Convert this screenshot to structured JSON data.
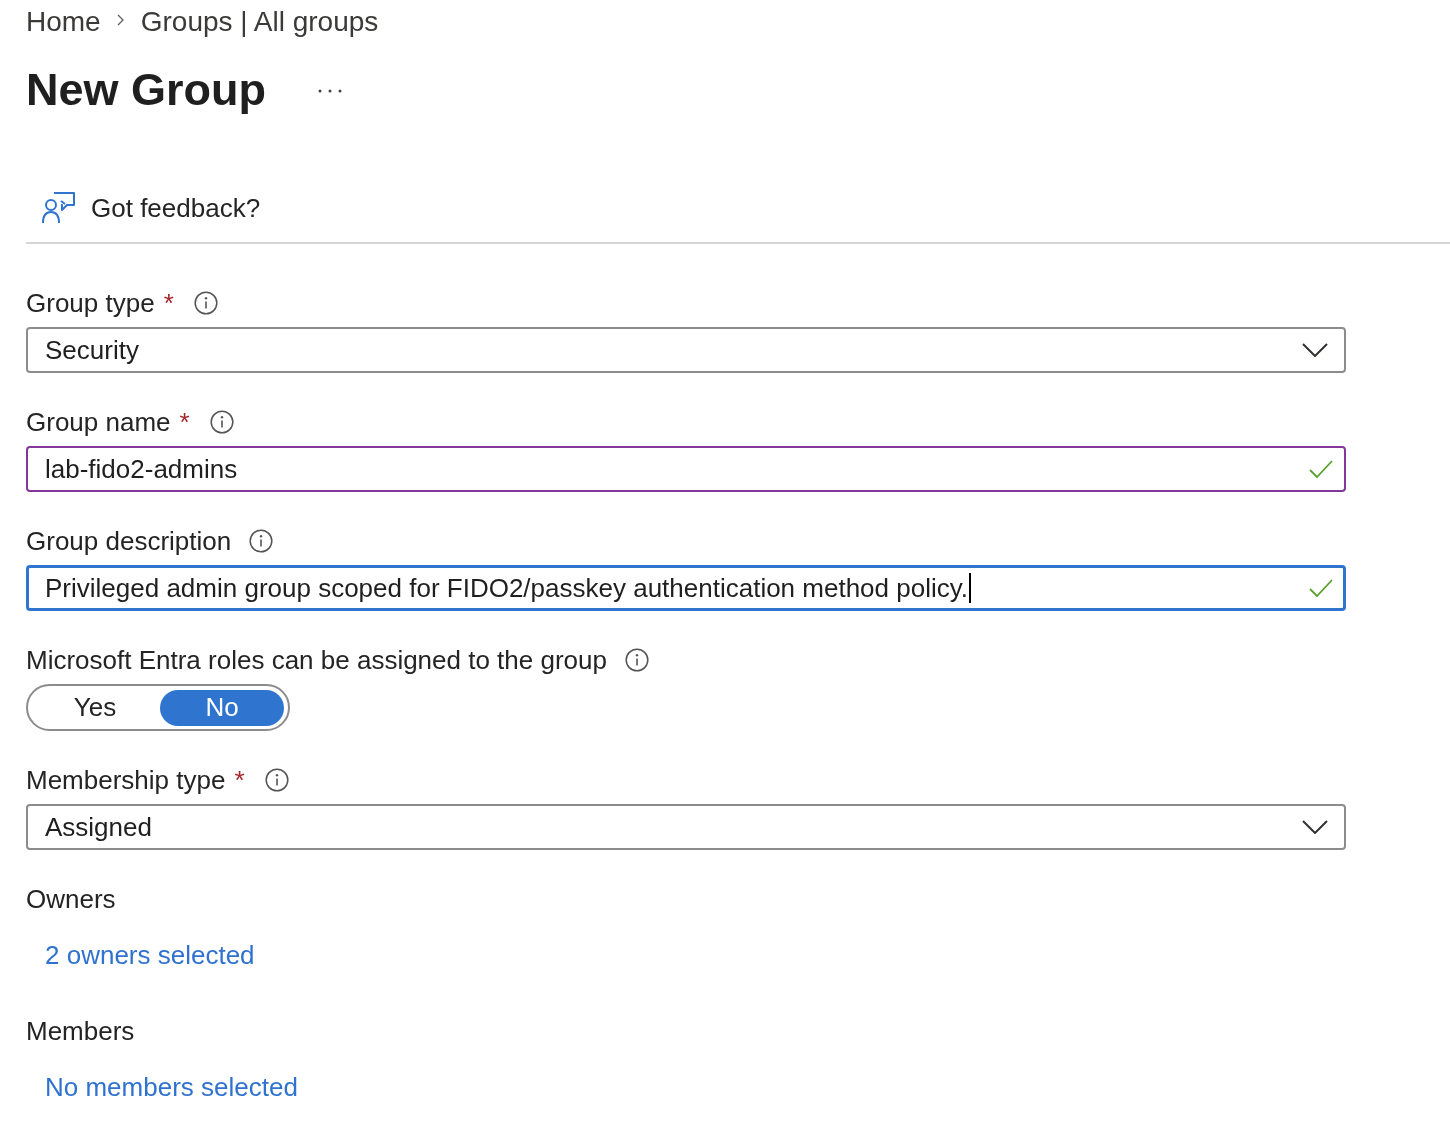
{
  "breadcrumb": [
    {
      "label": "Home"
    },
    {
      "label": "Groups | All groups"
    }
  ],
  "page": {
    "title": "New Group"
  },
  "toolbar": {
    "feedback": "Got feedback?"
  },
  "fields": [
    {
      "kind": "dropdown",
      "label": "Group type",
      "required_mark": "*",
      "info": true,
      "value": "Security"
    },
    {
      "kind": "text",
      "label": "Group name",
      "required_mark": "*",
      "info": true,
      "value": "lab-fido2-admins",
      "valid": true,
      "hovered": true,
      "focused": false
    },
    {
      "kind": "text",
      "label": "Group description",
      "info": true,
      "value": "Privileged admin group scoped for FIDO2/passkey authentication method policy.",
      "valid": true,
      "focused": true
    },
    {
      "kind": "toggle",
      "label": "Microsoft Entra roles can be assigned to the group",
      "info": true,
      "options": [
        {
          "label": "Yes",
          "selected": false
        },
        {
          "label": "No",
          "selected": true
        }
      ]
    },
    {
      "kind": "dropdown",
      "label": "Membership type",
      "required_mark": "*",
      "info": true,
      "value": "Assigned"
    },
    {
      "kind": "link",
      "label": "Owners",
      "link": "2 owners selected"
    },
    {
      "kind": "link",
      "label": "Members",
      "link": "No members selected"
    }
  ]
}
